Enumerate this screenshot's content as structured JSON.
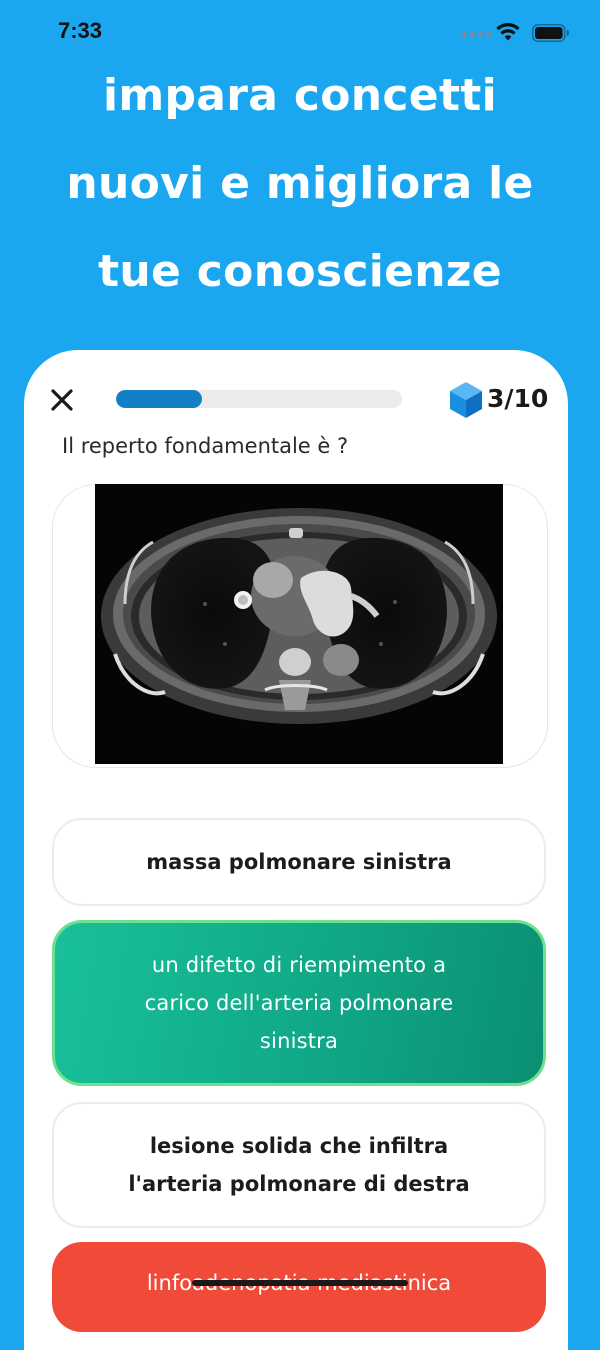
{
  "status_bar": {
    "time": "7:33"
  },
  "headline": "impara concetti\nnuovi e migliora le\ntue conoscienze",
  "quiz": {
    "progress": 0.3,
    "counter": "3/10",
    "question": "Il reperto fondamentale è ?",
    "answers": [
      {
        "text": "massa polmonare sinistra",
        "state": "default"
      },
      {
        "text": "un difetto di riempimento a\ncarico dell'arteria polmonare\nsinistra",
        "state": "correct"
      },
      {
        "text": "lesione solida che infiltra\nl'arteria polmonare di destra",
        "state": "default"
      },
      {
        "text": "linfoadenopatia mediastinica",
        "state": "wrong"
      }
    ]
  },
  "colors": {
    "background": "#1aa7f0",
    "progress_fill": "#1280c4",
    "correct": "#10a887",
    "wrong": "#f04a38",
    "cube": "#1a8fe0"
  },
  "icons": {
    "close": "close-icon",
    "cube": "cube-icon",
    "wifi": "wifi-icon",
    "battery": "battery-icon"
  }
}
